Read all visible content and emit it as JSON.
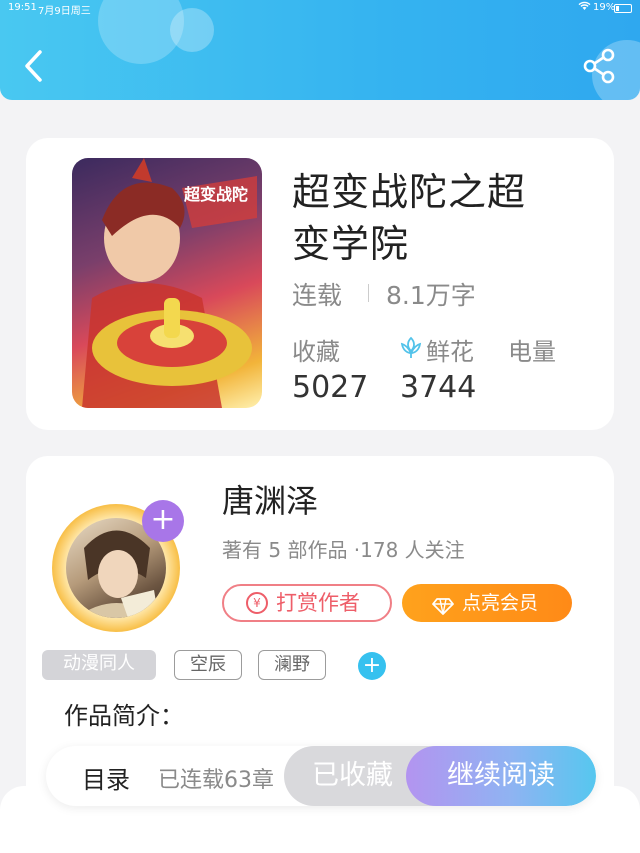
{
  "status_bar": {
    "time": "19:51",
    "date": "7月9日周三",
    "battery": "19%"
  },
  "book": {
    "title": "超变战陀之超变学院",
    "status": "连载",
    "word_count": "8.1万字",
    "stats": {
      "favorites_label": "收藏",
      "favorites_value": "5027",
      "flowers_label": "鲜花",
      "flowers_value": "3744",
      "power_label": "电量"
    }
  },
  "author": {
    "name": "唐渊泽",
    "info": "著有 5 部作品 ·178 人关注",
    "tip_label": "打赏作者",
    "vip_label": "点亮会员",
    "tags": [
      "动漫同人",
      "空辰",
      "澜野"
    ]
  },
  "intro": {
    "label": "作品简介："
  },
  "bottom_bar": {
    "toc_label": "目录",
    "toc_count": "已连载63章",
    "collected_label": "已收藏",
    "continue_label": "继续阅读"
  },
  "colors": {
    "header_blue": "#35b3f0",
    "accent_orange": "#ff8a17",
    "accent_red": "#ee5e69",
    "accent_purple": "#a876e8",
    "tag_add_blue": "#36c1ef"
  }
}
